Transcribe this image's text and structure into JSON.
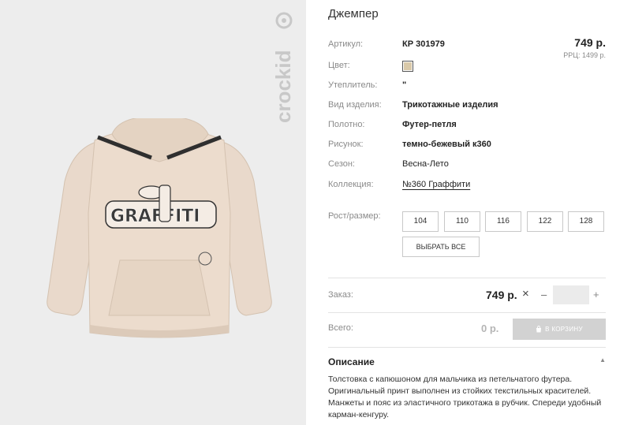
{
  "product": {
    "title": "Джемпер",
    "brand": "crockid"
  },
  "attributes": {
    "article": {
      "label": "Артикул:",
      "value": "КР 301979"
    },
    "color": {
      "label": "Цвет:",
      "swatch_color": "#d9c9a9"
    },
    "insulation": {
      "label": "Утеплитель:",
      "value": "\""
    },
    "item_type": {
      "label": "Вид изделия:",
      "value": "Трикотажные изделия"
    },
    "fabric": {
      "label": "Полотно:",
      "value": "Футер-петля"
    },
    "pattern": {
      "label": "Рисунок:",
      "value": "темно-бежевый к360"
    },
    "season": {
      "label": "Сезон:",
      "value": "Весна-Лето"
    },
    "collection": {
      "label": "Коллекция:",
      "value": "№360 Граффити"
    }
  },
  "pricing": {
    "price": "749 р.",
    "rrp": "РРЦ: 1499 р."
  },
  "sizes": {
    "label": "Рост/размер:",
    "options": [
      "104",
      "110",
      "116",
      "122",
      "128"
    ],
    "select_all": "ВЫБРАТЬ ВСЕ"
  },
  "order": {
    "label": "Заказ:",
    "price": "749 р.",
    "times": "×",
    "minus": "–",
    "plus": "+",
    "quantity": ""
  },
  "total": {
    "label": "Всего:",
    "value": "0 р.",
    "cart_button": "В КОРЗИНУ"
  },
  "description": {
    "title": "Описание",
    "caret": "▲",
    "text": "Толстовка с капюшоном для мальчика из петельчатого футера. Оригинальный принт выполнен из стойких текстильных красителей. Манжеты и пояс из эластичного трикотажа в рубчик. Спереди удобный карман-кенгуру."
  },
  "colors": {
    "hoodie": "#e9d9cb",
    "hoodie_shadow": "#dccab9",
    "stripe": "#2f2f2f",
    "panel_bg": "#ededed",
    "button_disabled": "#d2d2d2"
  }
}
